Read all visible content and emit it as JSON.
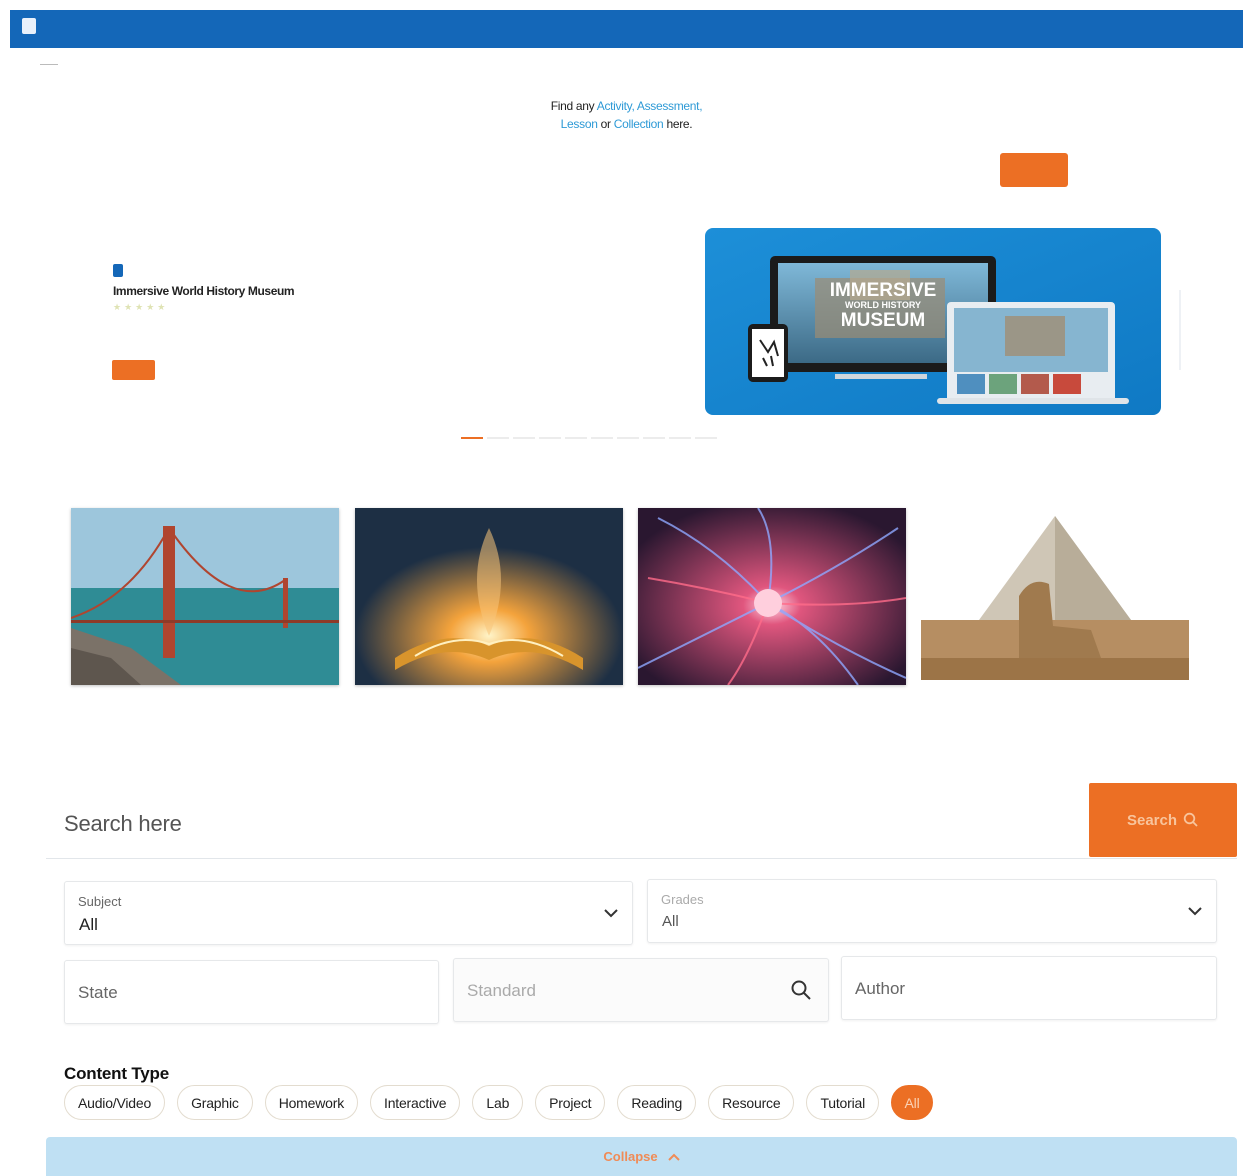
{
  "header": {
    "brand": "",
    "user_info": "",
    "links": [
      "",
      "",
      ""
    ]
  },
  "hero": {
    "find_prefix": "Find any ",
    "activity": "Activity",
    "sep1": ", ",
    "assessment": "Assessment",
    "sep2": ",",
    "lesson": "Lesson",
    "or": " or ",
    "collection": "Collection",
    "here": " here.",
    "search_placeholder": "",
    "search_button": "",
    "filters_link": ""
  },
  "featured": {
    "badge": "",
    "title": "Immersive World History Museum",
    "stars": "★★★★★",
    "desc_link": "",
    "desc_text": "",
    "explore": "",
    "image_text": {
      "line1": "IMMERSIVE",
      "line2": "WORLD HISTORY",
      "line3": "MUSEUM"
    }
  },
  "tabs": {
    "first": "",
    "second": ""
  },
  "search": {
    "placeholder": "Search here",
    "button": "Search"
  },
  "filters": {
    "subject_label": "Subject",
    "subject_value": "All",
    "grades_label": "Grades",
    "grades_value": "All",
    "state": "State",
    "standard": "Standard",
    "author": "Author"
  },
  "content_type": {
    "title": "Content Type",
    "chips": [
      "Audio/Video",
      "Graphic",
      "Homework",
      "Interactive",
      "Lab",
      "Project",
      "Reading",
      "Resource",
      "Tutorial"
    ],
    "active": "All"
  },
  "collapse": "Collapse",
  "icons": [
    "logo-icon",
    "search-icon",
    "chevron-down-icon",
    "chevron-up-icon"
  ],
  "colors": {
    "brand_blue": "#1467b8",
    "accent_orange": "#ec6f24",
    "link_blue": "#2e9ad6",
    "collapse_bg": "#bfe0f3"
  }
}
